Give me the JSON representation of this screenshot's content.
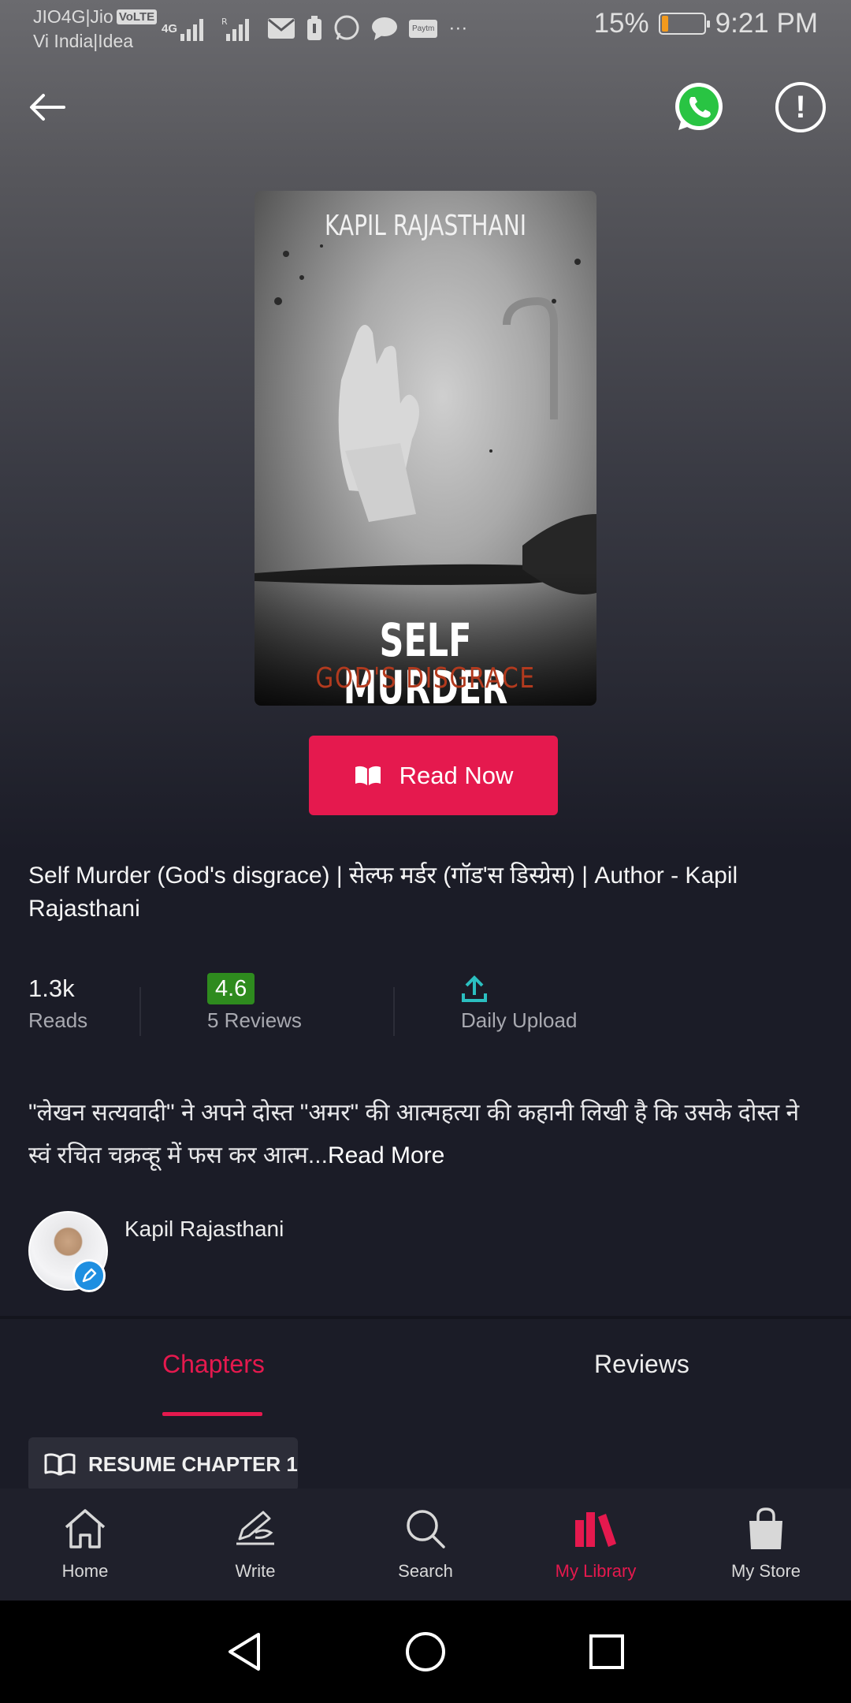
{
  "status_bar": {
    "carrier_1": "JIO4G|Jio",
    "volte": "VoLTE",
    "carrier_2": "Vi India|Idea",
    "net_label": "4G",
    "battery_percent": "15%",
    "battery_level": 0.15,
    "time": "9:21 PM",
    "paytm_label": "Paytm",
    "more": "···"
  },
  "cover": {
    "author": "KAPIL RAJASTHANI",
    "title": "SELF MURDER",
    "subtitle": "GOD'S DISGRACE"
  },
  "read_now_label": "Read Now",
  "book_title": "Self Murder (God's disgrace) | सेल्फ मर्डर (गॉड'स डिस्ग्रेस) | Author - Kapil Rajasthani",
  "stats": {
    "reads_count": "1.3k",
    "reads_label": "Reads",
    "rating": "4.6",
    "reviews_label": "5 Reviews",
    "upload_label": "Daily Upload"
  },
  "synopsis": {
    "text": "\"लेखन सत्यवादी\" ने अपने दोस्त \"अमर\" की आत्महत्या की कहानी लिखी है कि उसके दोस्त ने स्वं रचित चक्रव्हू में फस कर आत्म...",
    "read_more": "Read More"
  },
  "author": {
    "name": "Kapil Rajasthani"
  },
  "tabs": {
    "chapters": "Chapters",
    "reviews": "Reviews"
  },
  "resume_label": "RESUME CHAPTER 1",
  "nav": {
    "home": "Home",
    "write": "Write",
    "search": "Search",
    "library": "My Library",
    "store": "My Store"
  },
  "colors": {
    "accent": "#e5194e",
    "rating": "#2e8b1e",
    "background": "#1b1c27"
  }
}
